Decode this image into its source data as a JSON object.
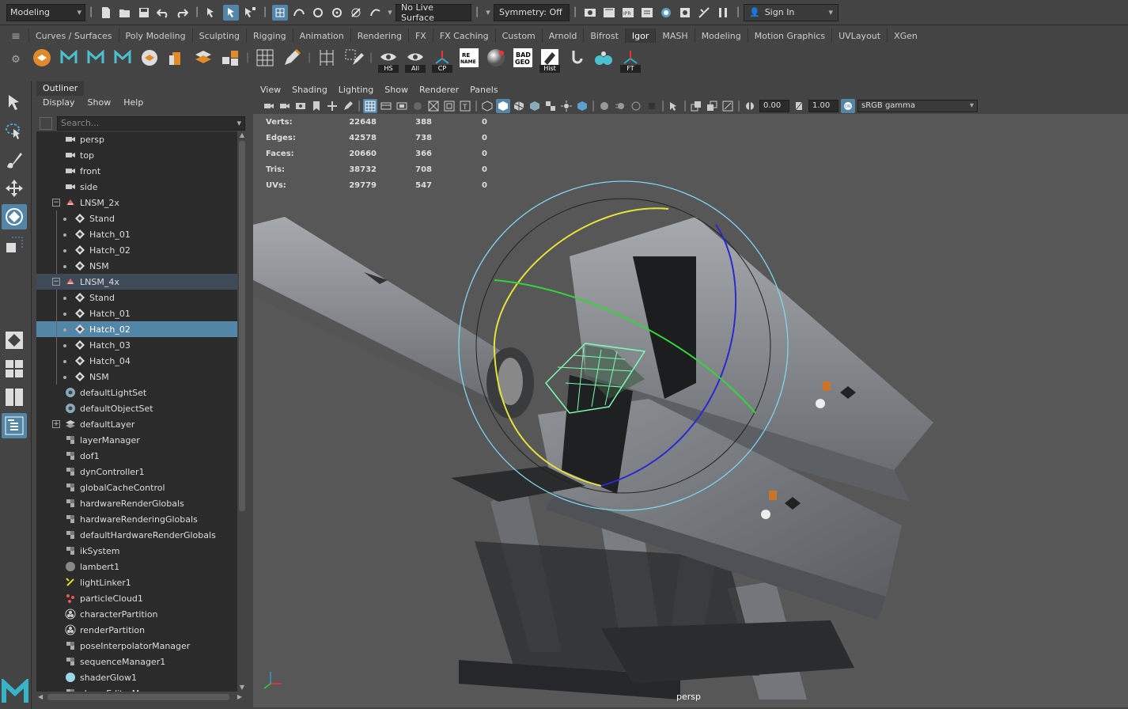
{
  "statusline": {
    "mode": "Modeling",
    "live_surface": "No Live Surface",
    "symmetry": "Symmetry: Off",
    "sign_in": "Sign In"
  },
  "shelf": {
    "tabs": [
      "Curves / Surfaces",
      "Poly Modeling",
      "Sculpting",
      "Rigging",
      "Animation",
      "Rendering",
      "FX",
      "FX Caching",
      "Custom",
      "Arnold",
      "Bifrost",
      "Igor",
      "MASH",
      "Modeling",
      "Motion Graphics",
      "UVLayout",
      "XGen"
    ],
    "selected_tab": "Igor",
    "icon_labels": {
      "hs": "HS",
      "all": "All",
      "cp": "CP",
      "rename": "RE NAME",
      "badgeo": "BAD GEO",
      "hist": "Hist",
      "ft": "FT"
    }
  },
  "outliner": {
    "tab": "Outliner",
    "menu": [
      "Display",
      "Show",
      "Help"
    ],
    "search_placeholder": "Search...",
    "items": [
      {
        "label": "persp",
        "icon": "camera-icon",
        "indent": 0
      },
      {
        "label": "top",
        "icon": "camera-icon",
        "indent": 0
      },
      {
        "label": "front",
        "icon": "camera-icon",
        "indent": 0
      },
      {
        "label": "side",
        "icon": "camera-icon",
        "indent": 0
      },
      {
        "label": "LNSM_2x",
        "icon": "group-icon",
        "indent": 0,
        "expand": "minus"
      },
      {
        "label": "Stand",
        "icon": "mesh-icon",
        "indent": 1
      },
      {
        "label": "Hatch_01",
        "icon": "mesh-icon",
        "indent": 1
      },
      {
        "label": "Hatch_02",
        "icon": "mesh-icon",
        "indent": 1
      },
      {
        "label": "NSM",
        "icon": "mesh-icon",
        "indent": 1
      },
      {
        "label": "LNSM_4x",
        "icon": "group-icon",
        "indent": 0,
        "expand": "minus",
        "state": "hl"
      },
      {
        "label": "Stand",
        "icon": "mesh-icon",
        "indent": 1
      },
      {
        "label": "Hatch_01",
        "icon": "mesh-icon",
        "indent": 1
      },
      {
        "label": "Hatch_02",
        "icon": "mesh-icon",
        "indent": 1,
        "state": "sel"
      },
      {
        "label": "Hatch_03",
        "icon": "mesh-icon",
        "indent": 1
      },
      {
        "label": "Hatch_04",
        "icon": "mesh-icon",
        "indent": 1
      },
      {
        "label": "NSM",
        "icon": "mesh-icon",
        "indent": 1
      },
      {
        "label": "defaultLightSet",
        "icon": "set-icon",
        "indent": 0
      },
      {
        "label": "defaultObjectSet",
        "icon": "set-icon",
        "indent": 0
      },
      {
        "label": "defaultLayer",
        "icon": "layer-icon",
        "indent": 0,
        "expand": "plus"
      },
      {
        "label": "layerManager",
        "icon": "node-icon",
        "indent": 0
      },
      {
        "label": "dof1",
        "icon": "node-icon",
        "indent": 0
      },
      {
        "label": "dynController1",
        "icon": "node-icon",
        "indent": 0
      },
      {
        "label": "globalCacheControl",
        "icon": "node-icon",
        "indent": 0
      },
      {
        "label": "hardwareRenderGlobals",
        "icon": "node-icon",
        "indent": 0
      },
      {
        "label": "hardwareRenderingGlobals",
        "icon": "node-icon",
        "indent": 0
      },
      {
        "label": "defaultHardwareRenderGlobals",
        "icon": "node-icon",
        "indent": 0
      },
      {
        "label": "ikSystem",
        "icon": "node-icon",
        "indent": 0
      },
      {
        "label": "lambert1",
        "icon": "sphere-icon",
        "indent": 0
      },
      {
        "label": "lightLinker1",
        "icon": "link-icon",
        "indent": 0
      },
      {
        "label": "particleCloud1",
        "icon": "particle-icon",
        "indent": 0
      },
      {
        "label": "characterPartition",
        "icon": "partition-icon",
        "indent": 0
      },
      {
        "label": "renderPartition",
        "icon": "partition-icon",
        "indent": 0
      },
      {
        "label": "poseInterpolatorManager",
        "icon": "node-icon",
        "indent": 0
      },
      {
        "label": "sequenceManager1",
        "icon": "node-icon",
        "indent": 0
      },
      {
        "label": "shaderGlow1",
        "icon": "glow-icon",
        "indent": 0
      },
      {
        "label": "shapeEditorManager",
        "icon": "node-icon",
        "indent": 0
      }
    ]
  },
  "viewport": {
    "menu": [
      "View",
      "Shading",
      "Lighting",
      "Show",
      "Renderer",
      "Panels"
    ],
    "exposure": "0.00",
    "gamma": "1.00",
    "color_space": "sRGB gamma",
    "camera_label": "persp",
    "hud": [
      {
        "k": "Verts:",
        "a": "22648",
        "b": "388",
        "c": "0"
      },
      {
        "k": "Edges:",
        "a": "42578",
        "b": "738",
        "c": "0"
      },
      {
        "k": "Faces:",
        "a": "20660",
        "b": "366",
        "c": "0"
      },
      {
        "k": "Tris:",
        "a": "38732",
        "b": "708",
        "c": "0"
      },
      {
        "k": "UVs:",
        "a": "29779",
        "b": "547",
        "c": "0"
      }
    ]
  },
  "colors": {
    "accent": "#5285a6",
    "panel": "#444444",
    "field": "#2b2b2b",
    "viewport": "#575757"
  }
}
